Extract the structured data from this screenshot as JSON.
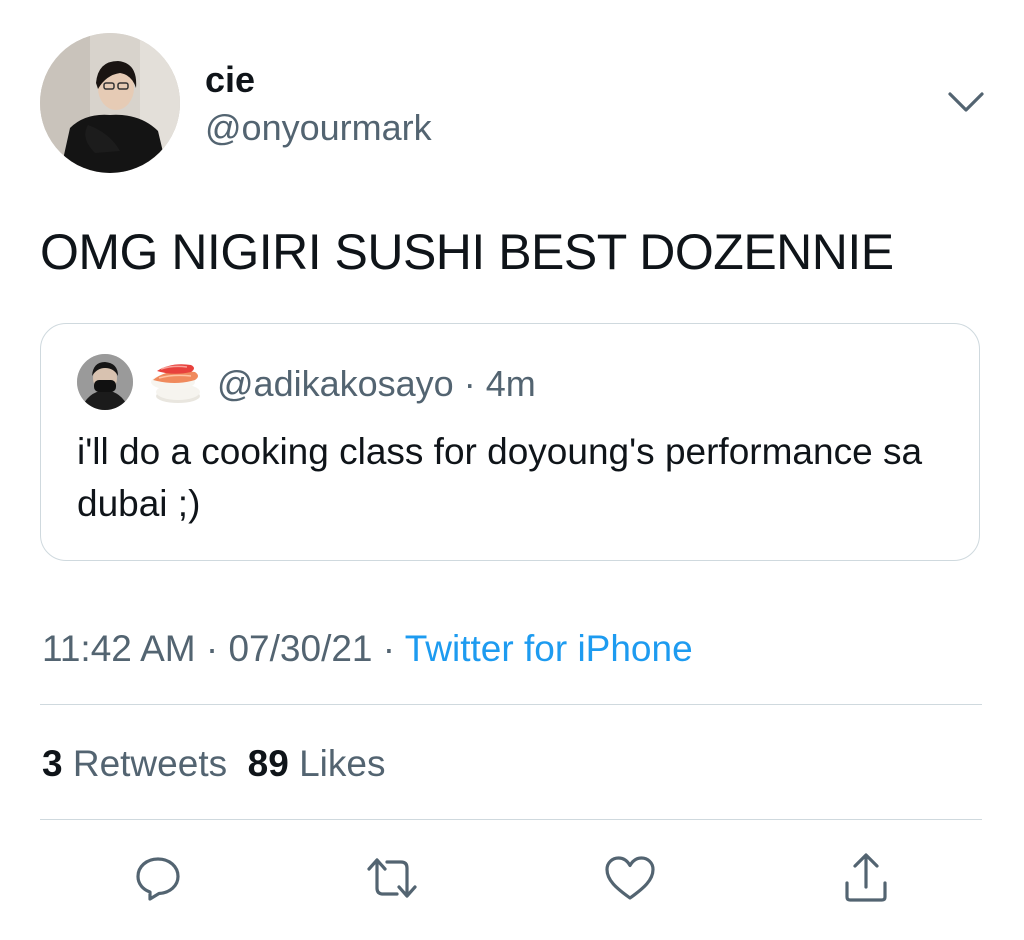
{
  "author": {
    "display_name": "cie",
    "handle": "@onyourmark"
  },
  "tweet": {
    "text": "OMG NIGIRI SUSHI BEST DOZENNIE"
  },
  "quoted_tweet": {
    "emoji_icon": "sushi-emoji",
    "handle": "@adikakosayo",
    "separator": "·",
    "time_ago": "4m",
    "text": "i'll do a cooking class for doyoung's performance sa dubai ;)"
  },
  "meta": {
    "time": "11:42 AM",
    "separator": "·",
    "date": "07/30/21",
    "source": "Twitter for iPhone"
  },
  "stats": {
    "retweets_count": "3",
    "retweets_label": "Retweets",
    "likes_count": "89",
    "likes_label": "Likes"
  },
  "actions": {
    "reply": "reply-icon",
    "retweet": "retweet-icon",
    "like": "heart-icon",
    "share": "share-icon"
  },
  "colors": {
    "text_primary": "#0f1419",
    "text_secondary": "#536471",
    "link": "#1d9bf0",
    "border": "#cfd9de"
  }
}
